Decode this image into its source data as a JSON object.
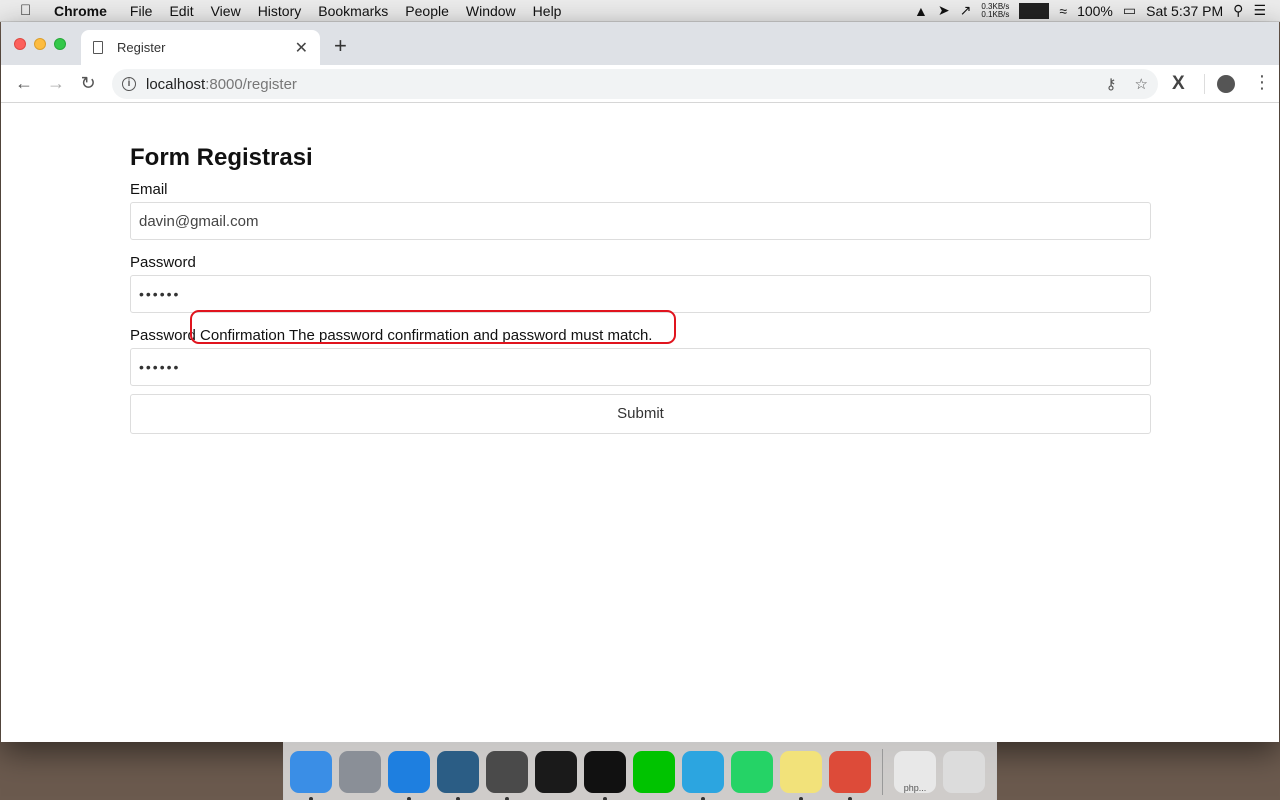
{
  "menubar": {
    "app_name": "Chrome",
    "items": [
      "File",
      "Edit",
      "View",
      "History",
      "Bookmarks",
      "People",
      "Window",
      "Help"
    ],
    "net_up": "0.3KB/s",
    "net_down": "0.1KB/s",
    "battery": "100%",
    "clock": "Sat 5:37 PM"
  },
  "browser": {
    "tab_title": "Register",
    "url_host": "localhost",
    "url_path": ":8000/register"
  },
  "form": {
    "title": "Form Registrasi",
    "email_label": "Email",
    "email_value": "davin@gmail.com",
    "password_label": "Password",
    "password_value": "••••••",
    "confirm_label": "Password Confirmation",
    "confirm_error": "The password confirmation and password must match.",
    "confirm_value": "••••••",
    "submit_label": "Submit"
  },
  "dock": {
    "items": [
      {
        "name": "finder-icon",
        "color": "#3a8ee6",
        "running": true
      },
      {
        "name": "launchpad-icon",
        "color": "#8a8f97",
        "running": false
      },
      {
        "name": "safari-icon",
        "color": "#1e7fe0",
        "running": true
      },
      {
        "name": "mysql-workbench-icon",
        "color": "#2b5d85",
        "running": true
      },
      {
        "name": "sublime-text-icon",
        "color": "#4a4a4a",
        "running": true
      },
      {
        "name": "p3-icon",
        "color": "#1a1a1a",
        "running": false
      },
      {
        "name": "terminal-icon",
        "color": "#111111",
        "running": true
      },
      {
        "name": "line-icon",
        "color": "#00c300",
        "running": false
      },
      {
        "name": "telegram-icon",
        "color": "#2ca5e0",
        "running": true
      },
      {
        "name": "whatsapp-icon",
        "color": "#25d366",
        "running": false
      },
      {
        "name": "stickies-icon",
        "color": "#f2e27a",
        "running": true
      },
      {
        "name": "chrome-icon",
        "color": "#dd4b39",
        "running": true
      }
    ],
    "minimized_label": "php...",
    "trash": "trash-icon"
  }
}
